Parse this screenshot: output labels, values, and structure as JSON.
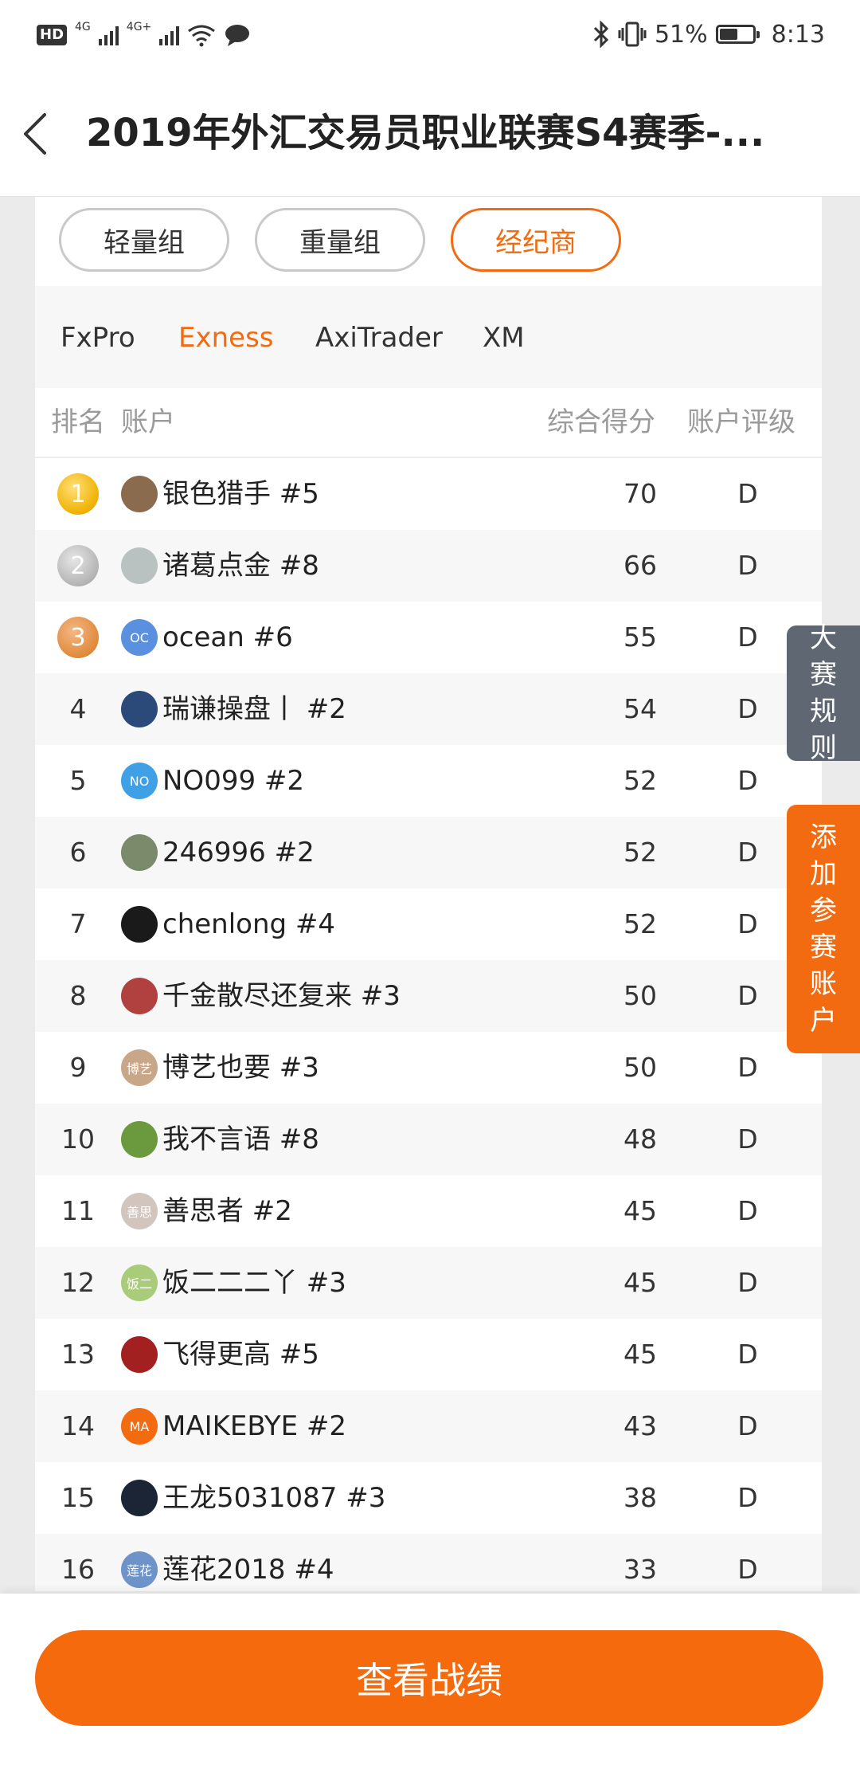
{
  "status_bar": {
    "hd": "HD",
    "net1": "4G",
    "net2": "4G+",
    "battery": "51%",
    "time": "8:13"
  },
  "header": {
    "title": "2019年外汇交易员职业联赛S4赛季-..."
  },
  "group_tabs": [
    {
      "label": "轻量组",
      "active": false
    },
    {
      "label": "重量组",
      "active": false
    },
    {
      "label": "经纪商",
      "active": true
    }
  ],
  "broker_tabs": [
    {
      "label": "FxPro",
      "active": false
    },
    {
      "label": "Exness",
      "active": true
    },
    {
      "label": "AxiTrader",
      "active": false
    },
    {
      "label": "XM",
      "active": false
    }
  ],
  "table": {
    "headers": {
      "rank": "排名",
      "account": "账户",
      "score": "综合得分",
      "rating": "账户评级"
    },
    "rows": [
      {
        "rank": "1",
        "name": "银色猎手  #5",
        "score": "70",
        "rating": "D",
        "avatar_text": "",
        "avatar_color": "#8a6b4e"
      },
      {
        "rank": "2",
        "name": "诸葛点金  #8",
        "score": "66",
        "rating": "D",
        "avatar_text": "",
        "avatar_color": "#b9c2c0"
      },
      {
        "rank": "3",
        "name": "ocean  #6",
        "score": "55",
        "rating": "D",
        "avatar_text": "OC",
        "avatar_color": "#5b8fe0"
      },
      {
        "rank": "4",
        "name": "瑞谦操盘丨  #2",
        "score": "54",
        "rating": "D",
        "avatar_text": "",
        "avatar_color": "#2b4a7a"
      },
      {
        "rank": "5",
        "name": "NO099  #2",
        "score": "52",
        "rating": "D",
        "avatar_text": "NO",
        "avatar_color": "#3fa0e6"
      },
      {
        "rank": "6",
        "name": "246996  #2",
        "score": "52",
        "rating": "D",
        "avatar_text": "",
        "avatar_color": "#7a8a6a"
      },
      {
        "rank": "7",
        "name": "chenlong  #4",
        "score": "52",
        "rating": "D",
        "avatar_text": "",
        "avatar_color": "#1a1a1a"
      },
      {
        "rank": "8",
        "name": "千金散尽还复来  #3",
        "score": "50",
        "rating": "D",
        "avatar_text": "",
        "avatar_color": "#b0413e"
      },
      {
        "rank": "9",
        "name": "博艺也要  #3",
        "score": "50",
        "rating": "D",
        "avatar_text": "博艺",
        "avatar_color": "#c8a789"
      },
      {
        "rank": "10",
        "name": "我不言语  #8",
        "score": "48",
        "rating": "D",
        "avatar_text": "",
        "avatar_color": "#6b9a3e"
      },
      {
        "rank": "11",
        "name": "善思者  #2",
        "score": "45",
        "rating": "D",
        "avatar_text": "善思",
        "avatar_color": "#d1c5bd"
      },
      {
        "rank": "12",
        "name": "饭二二二丫  #3",
        "score": "45",
        "rating": "D",
        "avatar_text": "饭二",
        "avatar_color": "#a9cc7a"
      },
      {
        "rank": "13",
        "name": "飞得更高  #5",
        "score": "45",
        "rating": "D",
        "avatar_text": "",
        "avatar_color": "#a32020"
      },
      {
        "rank": "14",
        "name": "MAIKEBYE  #2",
        "score": "43",
        "rating": "D",
        "avatar_text": "MA",
        "avatar_color": "#f36b10"
      },
      {
        "rank": "15",
        "name": "王龙5031087  #3",
        "score": "38",
        "rating": "D",
        "avatar_text": "",
        "avatar_color": "#1b2536"
      },
      {
        "rank": "16",
        "name": "莲花2018  #4",
        "score": "33",
        "rating": "D",
        "avatar_text": "莲花",
        "avatar_color": "#6d93c8"
      }
    ]
  },
  "float_buttons": {
    "rules": "大赛规则",
    "add_account": "添加参赛账户"
  },
  "bottom": {
    "view_record": "查看战绩"
  },
  "colors": {
    "accent": "#f36b10",
    "rules_bg": "#5f6872"
  },
  "icons": {
    "back": "back-icon",
    "bluetooth": "bluetooth-icon",
    "vibrate": "vibrate-icon",
    "wifi": "wifi-icon",
    "message": "message-icon",
    "battery": "battery-icon"
  }
}
